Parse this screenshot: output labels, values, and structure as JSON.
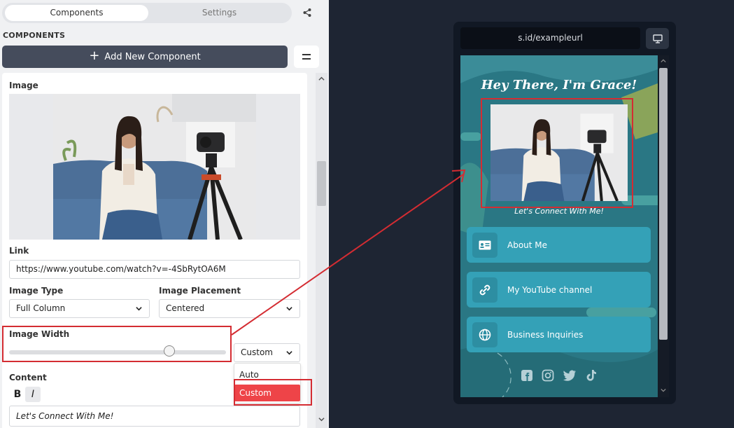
{
  "tabs": [
    {
      "label": "Components"
    },
    {
      "label": "Settings"
    }
  ],
  "components_title": "COMPONENTS",
  "add_button_label": "Add New Component",
  "image_component": {
    "title": "Image",
    "link_label": "Link",
    "link_value": "https://www.youtube.com/watch?v=-4SbRytOA6M",
    "image_type_label": "Image Type",
    "image_type_value": "Full Column",
    "image_placement_label": "Image Placement",
    "image_placement_value": "Centered",
    "image_width_label": "Image Width",
    "image_width_value": "Custom",
    "image_width_slider": 0.74,
    "width_options": [
      {
        "label": "Auto"
      },
      {
        "label": "Custom"
      }
    ],
    "content_label": "Content",
    "bold_label": "B",
    "italic_label": "I",
    "content_value": "Let's Connect With Me!"
  },
  "preview": {
    "url": "s.id/exampleurl",
    "heading": "Hey There, I'm Grace!",
    "caption": "Let's Connect With Me!",
    "links": [
      {
        "label": "About Me",
        "icon": "id-card-icon"
      },
      {
        "label": "My YouTube channel",
        "icon": "link-icon"
      },
      {
        "label": "Business Inquiries",
        "icon": "globe-icon"
      }
    ],
    "socials": [
      "facebook-icon",
      "instagram-icon",
      "twitter-icon",
      "tiktok-icon"
    ]
  },
  "colors": {
    "highlight": "#d42c32",
    "preview_bg": "#2a7784",
    "link_button": "#34a1b7",
    "selected_option": "#ee4448"
  }
}
